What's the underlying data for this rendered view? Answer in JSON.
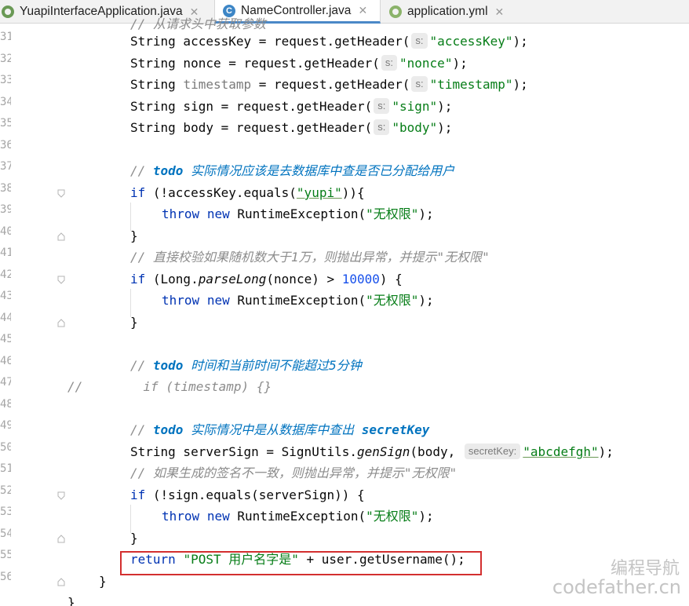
{
  "tabs": [
    {
      "label": "YuapiInterfaceApplication.java",
      "icon": "spring-boot-class-icon",
      "active": false
    },
    {
      "label": "NameController.java",
      "icon": "java-class-icon",
      "active": true
    },
    {
      "label": "application.yml",
      "icon": "spring-yaml-icon",
      "active": false
    }
  ],
  "tab_close": "✕",
  "class_icon_letter": "C",
  "gutter": {
    "line_numbers": [
      "31",
      "32",
      "33",
      "34",
      "35",
      "36",
      "37",
      "38",
      "39",
      "40",
      "41",
      "42",
      "43",
      "44",
      "45",
      "46",
      "47",
      "48",
      "49",
      "50",
      "51",
      "52",
      "53",
      "54",
      "55",
      "56"
    ]
  },
  "code": {
    "top_partial": "// 从请求头中获取参数",
    "l31": {
      "a": "String accessKey = request.getHeader(",
      "hint": "s:",
      "s": "\"accessKey\"",
      "b": ");"
    },
    "l32": {
      "a": "String nonce = request.getHeader(",
      "hint": "s:",
      "s": "\"nonce\"",
      "b": ");"
    },
    "l33": {
      "a1": "String ",
      "a2": "timestamp",
      "a3": " = request.getHeader(",
      "hint": "s:",
      "s": "\"timestamp\"",
      "b": ");"
    },
    "l34": {
      "a": "String sign = request.getHeader(",
      "hint": "s:",
      "s": "\"sign\"",
      "b": ");"
    },
    "l35": {
      "a": "String body = request.getHeader(",
      "hint": "s:",
      "s": "\"body\"",
      "b": ");"
    },
    "l37": {
      "c": "// ",
      "todo": "todo",
      "text": " 实际情况应该是去数据库中查是否已分配给用户"
    },
    "l38": {
      "kw": "if",
      "a": " (!accessKey.equals(",
      "s": "\"yupi\"",
      "b": ")){"
    },
    "l39": {
      "kw1": "throw",
      "kw2": "new",
      "a": " RuntimeException(",
      "s": "\"无权限\"",
      "b": ");"
    },
    "l40": "}",
    "l41": "// 直接校验如果随机数大于1万，则抛出异常，并提示\"无权限\"",
    "l42": {
      "kw": "if",
      "a": " (Long.",
      "fn": "parseLong",
      "b": "(nonce) > ",
      "num": "10000",
      "c": ") {"
    },
    "l43": {
      "kw1": "throw",
      "kw2": "new",
      "a": " RuntimeException(",
      "s": "\"无权限\"",
      "b": ");"
    },
    "l44": "}",
    "l46": {
      "c": "// ",
      "todo": "todo",
      "text": " 时间和当前时间不能超过5分钟"
    },
    "l47": "//        if (timestamp) {}",
    "l49": {
      "c": "// ",
      "todo": "todo",
      "text": " 实际情况中是从数据库中查出 ",
      "key": "secretKey"
    },
    "l50": {
      "a": "String serverSign = SignUtils.",
      "fn": "genSign",
      "b": "(body, ",
      "hint": "secretKey:",
      "s": "\"abcdefgh\"",
      "c": ");"
    },
    "l51": "// 如果生成的签名不一致，则抛出异常，并提示\"无权限\"",
    "l52": {
      "kw": "if",
      "a": " (!sign.equals(serverSign)) {"
    },
    "l53": {
      "kw1": "throw",
      "kw2": "new",
      "a": " RuntimeException(",
      "s": "\"无权限\"",
      "b": ");"
    },
    "l54": "}",
    "l55": {
      "kw": "return",
      "s": "\"POST 用户名字是\"",
      "b": " + user.getUsername();"
    },
    "l56": "}",
    "l57": "}"
  },
  "watermark": {
    "line1": "编程导航",
    "line2": "codefather.cn"
  },
  "colors": {
    "keyword": "#0033b3",
    "string": "#067d17",
    "number": "#1750eb",
    "comment": "#8c8c8c",
    "todo": "#0073bf",
    "highlight": "#d32f2f"
  }
}
